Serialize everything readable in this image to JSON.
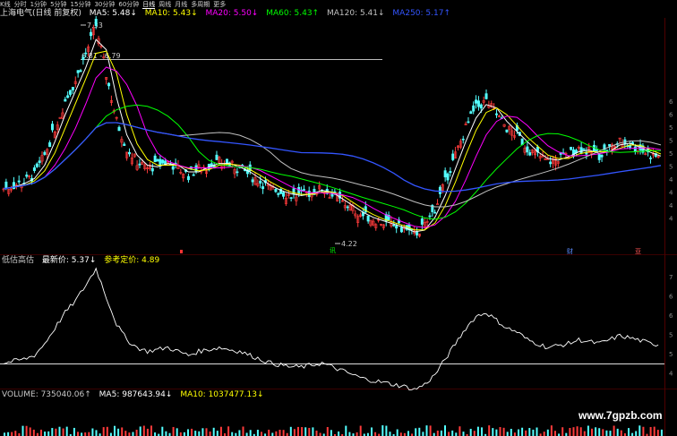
{
  "toolbar": {
    "items": [
      "K线",
      "分时",
      "1分钟",
      "5分钟",
      "15分钟",
      "30分钟",
      "60分钟",
      "日线",
      "周线",
      "月线",
      "多周期",
      "更多"
    ],
    "active_index": 7
  },
  "main_legend": {
    "title": "上海电气(日线 前复权)",
    "ma5": "MA5: 5.48↓",
    "ma10": "MA10: 5.43↓",
    "ma20": "MA20: 5.50↓",
    "ma60": "MA60: 5.43↑",
    "ma120": "MA120: 5.41↓",
    "ma250": "MA250: 5.17↑",
    "colors": {
      "ma5": "#ffffff",
      "ma10": "#ffff00",
      "ma20": "#ff00ff",
      "ma60": "#00ff00",
      "ma120": "#c0c0c0",
      "ma250": "#3355ff"
    }
  },
  "annotations": {
    "high_label": "7.33",
    "range_label": "6.81 - 6.79",
    "low_label": "4.22",
    "marker_caixun": "讯",
    "marker_cai": "财",
    "marker_ya": "亚"
  },
  "price_axis_labels": [
    "6",
    "6",
    "5",
    "5",
    "5",
    "5",
    "4",
    "4",
    "4",
    "4"
  ],
  "indicator_legend": {
    "name": "低估高估",
    "latest": "最新价: 5.37↓",
    "reference": "参考定价: 4.89",
    "colors": {
      "latest": "#ffffff",
      "reference": "#ffff00"
    }
  },
  "indicator_axis_labels": [
    "7",
    "6",
    "6",
    "5",
    "5",
    "4"
  ],
  "volume_legend": {
    "name": "VOLUME: 735040.06↑",
    "ma5": "MA5: 987643.94↓",
    "ma10": "MA10: 1037477.13↓"
  },
  "watermark": "www.7gpzb.com",
  "chart_data": {
    "type": "line",
    "price_series_approx": [
      4.9,
      4.95,
      5.0,
      5.1,
      5.4,
      5.8,
      6.2,
      6.5,
      6.9,
      7.33,
      6.6,
      5.9,
      5.5,
      5.3,
      5.2,
      5.25,
      5.3,
      5.2,
      5.1,
      5.2,
      5.25,
      5.3,
      5.25,
      5.2,
      5.1,
      5.0,
      4.9,
      4.85,
      4.8,
      4.8,
      4.85,
      4.9,
      4.8,
      4.7,
      4.6,
      4.5,
      4.45,
      4.4,
      4.35,
      4.3,
      4.22,
      4.35,
      4.6,
      5.0,
      5.4,
      5.8,
      6.1,
      6.2,
      6.0,
      5.8,
      5.7,
      5.5,
      5.4,
      5.3,
      5.35,
      5.4,
      5.5,
      5.45,
      5.4,
      5.5,
      5.6,
      5.55,
      5.48,
      5.4,
      5.37
    ],
    "reference_price": 4.89
  }
}
